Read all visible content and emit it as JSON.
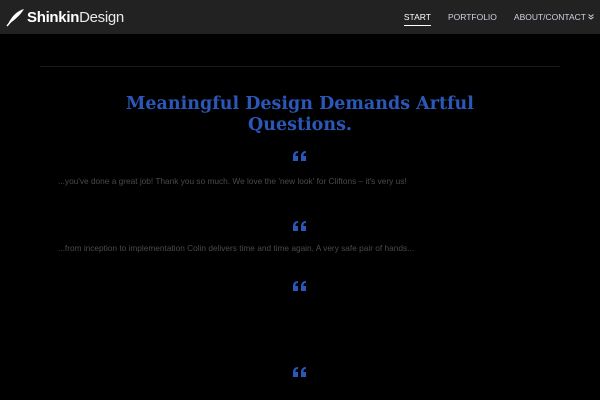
{
  "brand": {
    "name_bold": "Shinkin",
    "name_light": "Design"
  },
  "nav": {
    "items": [
      {
        "label": "START",
        "active": true
      },
      {
        "label": "PORTFOLIO",
        "active": false
      },
      {
        "label": "ABOUT/CONTACT",
        "active": false
      }
    ]
  },
  "hero": {
    "headline_line1": "Meaningful Design Demands Artful",
    "headline_line2": "Questions."
  },
  "testimonials": [
    {
      "text": "...you've done a great job! Thank you so much. We love the 'new look' for Cliftons – it's very us!"
    },
    {
      "text": "...from inception to implementation Colin delivers time and time again. A very safe pair of hands..."
    },
    {
      "text": ""
    },
    {
      "text": ""
    }
  ],
  "colors": {
    "accent": "#2b57b8",
    "header_bg": "#222222",
    "page_bg": "#000000"
  }
}
